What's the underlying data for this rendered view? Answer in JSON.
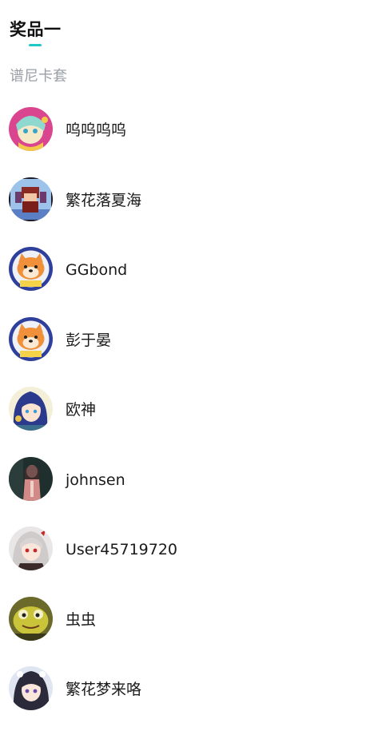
{
  "prize": {
    "title": "奖品一",
    "name": "谱尼卡套"
  },
  "colors": {
    "accent": "#1ec8c8",
    "subtle_text": "#9a9fa6"
  },
  "winners": [
    {
      "name": "呜呜呜呜",
      "avatar": "anime-girl-pink-avatar"
    },
    {
      "name": "繁花落夏海",
      "avatar": "pixel-character-avatar"
    },
    {
      "name": "GGbond",
      "avatar": "shiba-dog-avatar"
    },
    {
      "name": "彭于晏",
      "avatar": "shiba-dog-avatar"
    },
    {
      "name": "欧神",
      "avatar": "anime-girl-blue-hair-avatar"
    },
    {
      "name": "johnsen",
      "avatar": "dark-photo-avatar"
    },
    {
      "name": "User45719720",
      "avatar": "anime-girl-white-hair-avatar"
    },
    {
      "name": "虫虫",
      "avatar": "yellow-frog-avatar"
    },
    {
      "name": "繁花梦来咯",
      "avatar": "anime-girl-dark-hair-avatar"
    }
  ]
}
